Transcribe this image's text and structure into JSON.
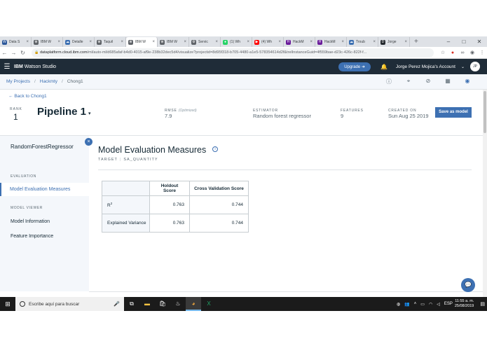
{
  "browser": {
    "tabs": [
      {
        "label": "Data S",
        "icon": "W",
        "color": "#2b579a"
      },
      {
        "label": "IBM W",
        "icon": "⊗",
        "color": "#5f6368"
      },
      {
        "label": "Detalle",
        "icon": "☁",
        "color": "#3d70b2"
      },
      {
        "label": "Taquil",
        "icon": "⊗",
        "color": "#5f6368"
      },
      {
        "label": "IBM W",
        "icon": "⊗",
        "color": "#5f6368"
      },
      {
        "label": "IBM W",
        "icon": "⊗",
        "color": "#5f6368"
      },
      {
        "label": "Servic",
        "icon": "⚙",
        "color": "#5f6368"
      },
      {
        "label": "(1) Wh",
        "icon": "●",
        "color": "#25d366"
      },
      {
        "label": "(4) Wh",
        "icon": "▶",
        "color": "#ff0000"
      },
      {
        "label": "HackM",
        "icon": "H",
        "color": "#6a1b9a"
      },
      {
        "label": "HackM",
        "icon": "H",
        "color": "#6a1b9a"
      },
      {
        "label": "Troub",
        "icon": "☁",
        "color": "#3d70b2"
      },
      {
        "label": "Jorge",
        "icon": "D",
        "color": "#24292e"
      }
    ],
    "new_tab": "+",
    "window_controls": [
      "–",
      "□",
      "✕"
    ],
    "url_host": "dataplatform.cloud.ibm.com",
    "url_path": "/ml/auto-ml/d685afaf-b4d0-4015-af9e-238b32dec5d4/visualize?projectid=8d95f318-b705-4480-a1e5-578354614d2f&trelInstanceGuid=4f559bae-d23c-426c-822f-f..."
  },
  "watson": {
    "brand_ibm": "IBM",
    "brand_product": "Watson Studio",
    "upgrade_label": "Upgrade",
    "account_name": "Jorge Perez Mojica's Account",
    "avatar_initials": "JP"
  },
  "breadcrumb": {
    "items": [
      "My Projects",
      "Hackmty",
      "Chong1"
    ]
  },
  "pipeline": {
    "back_link": "Back to Chong1",
    "rank_label": "RANK",
    "rank_value": "1",
    "title": "Pipeline 1",
    "rmse_label": "RMSE",
    "rmse_note": "(Optimized)",
    "rmse_value": "7.9",
    "estimator_label": "ESTIMATOR",
    "estimator_value": "Random forest regressor",
    "features_label": "FEATURES",
    "features_value": "9",
    "created_label": "CREATED ON",
    "created_value": "Sun Aug 25 2019",
    "save_label": "Save as model"
  },
  "sidebar": {
    "title": "RandomForestRegressor",
    "section_evaluation": "EVALUATION",
    "item_evaluation": "Model Evaluation Measures",
    "section_viewer": "MODEL VIEWER",
    "item_information": "Model Information",
    "item_importance": "Feature Importance"
  },
  "main": {
    "title": "Model Evaluation Measures",
    "target_label": "TARGET",
    "target_value": "SA_QUANTITY",
    "table": {
      "headers": [
        "Holdout Score",
        "Cross Validation Score"
      ],
      "rows": [
        {
          "label_base": "R",
          "label_sup": "2",
          "holdout": "0.763",
          "cv": "0.744"
        },
        {
          "label_base": "Explained Variance",
          "label_sup": "",
          "holdout": "0.763",
          "cv": "0.744"
        }
      ]
    }
  },
  "taskbar": {
    "search_placeholder": "Escribe aquí para buscar",
    "language": "ESP",
    "time": "11:55 a. m.",
    "date": "25/08/2019"
  }
}
